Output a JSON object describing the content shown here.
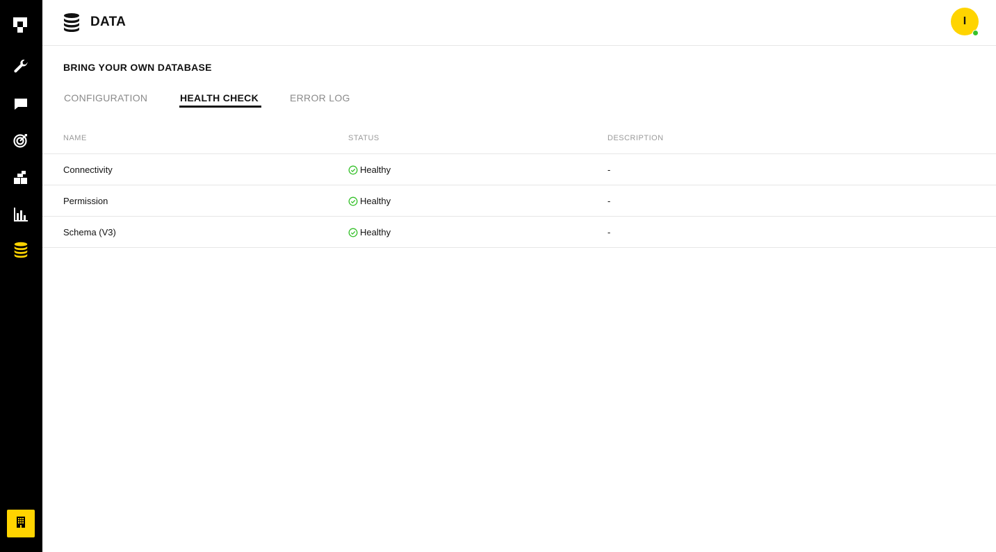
{
  "sidebar": {
    "items": [
      {
        "name": "logo-icon"
      },
      {
        "name": "wrench-icon"
      },
      {
        "name": "chat-icon"
      },
      {
        "name": "target-icon"
      },
      {
        "name": "blocks-icon"
      },
      {
        "name": "bar-chart-icon"
      },
      {
        "name": "database-icon",
        "active": true
      }
    ],
    "bottom": {
      "name": "building-icon"
    }
  },
  "header": {
    "title": "DATA",
    "icon": "database-icon",
    "avatar_initial": "I"
  },
  "main": {
    "section_title": "BRING YOUR OWN DATABASE",
    "tabs": [
      {
        "label": "CONFIGURATION"
      },
      {
        "label": "HEALTH CHECK",
        "active": true
      },
      {
        "label": "ERROR LOG"
      }
    ],
    "table": {
      "headers": {
        "name": "NAME",
        "status": "STATUS",
        "description": "DESCRIPTION"
      },
      "rows": [
        {
          "name": "Connectivity",
          "status": "Healthy",
          "description": "-"
        },
        {
          "name": "Permission",
          "status": "Healthy",
          "description": "-"
        },
        {
          "name": "Schema (V3)",
          "status": "Healthy",
          "description": "-"
        }
      ]
    }
  },
  "colors": {
    "accent": "#FFD400",
    "healthy": "#36c12b",
    "sidebar_bg": "#000000"
  }
}
